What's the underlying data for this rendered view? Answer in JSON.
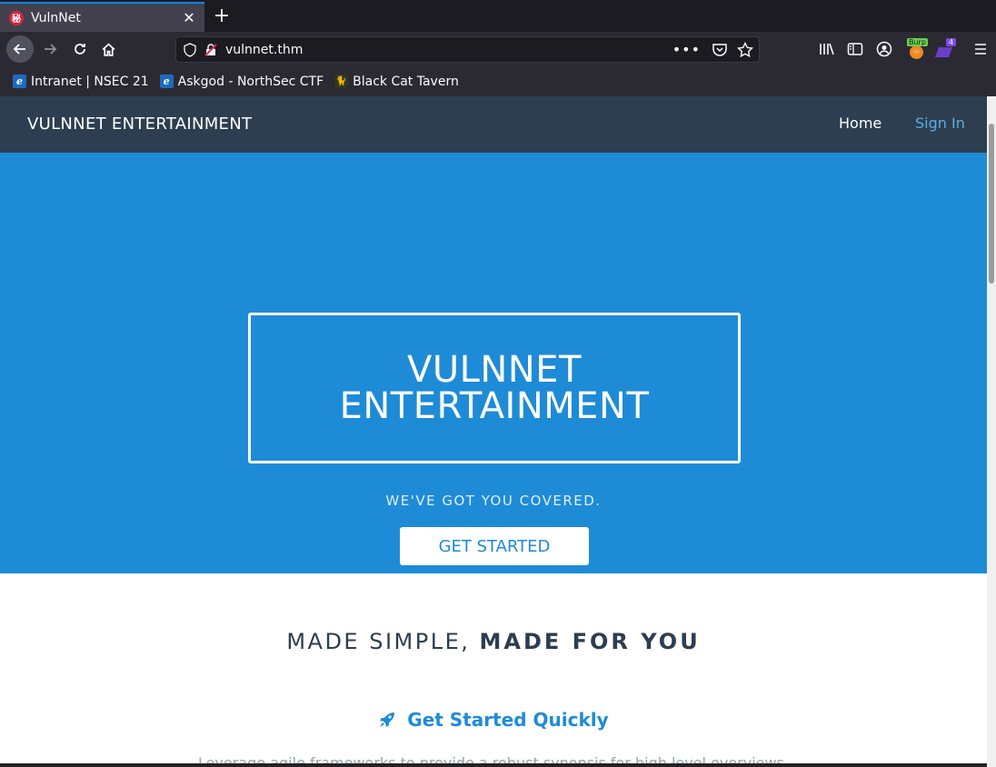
{
  "browser": {
    "tab_title": "VulnNet",
    "tab_icon_glyph": "秘",
    "new_tab": "+",
    "close_glyph": "✕",
    "url": "vulnnet.thm",
    "burp_badge": "Burp",
    "ext_count": "4",
    "bookmarks": [
      {
        "label": "Intranet | NSEC 21",
        "icon": "e"
      },
      {
        "label": "Askgod - NorthSec CTF",
        "icon": "e"
      },
      {
        "label": "Black Cat Tavern",
        "icon": "cat"
      }
    ],
    "accent": "#0a84ff"
  },
  "site": {
    "brand": "VULNNET ENTERTAINMENT",
    "nav": {
      "home": "Home",
      "signin": "Sign In"
    },
    "hero": {
      "title": "VULNNET ENTERTAINMENT",
      "subtitle": "WE'VE GOT YOU COVERED.",
      "cta": "GET STARTED"
    },
    "section": {
      "title_light": "MADE SIMPLE, ",
      "title_bold": "MADE FOR YOU"
    },
    "feature": {
      "title": "Get Started Quickly",
      "description": "Leverage agile frameworks to provide a robust synopsis for high level overviews."
    },
    "colors": {
      "nav_bg": "#2c3e50",
      "hero_bg": "#1e8bd7",
      "link": "#5dade2"
    }
  }
}
